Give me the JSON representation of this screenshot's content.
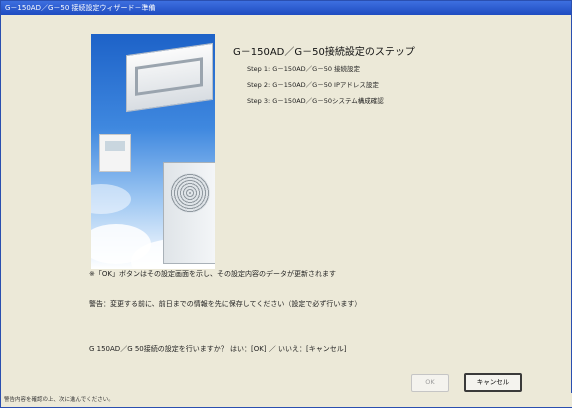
{
  "window": {
    "title": "G－150AD／G－50 接続設定ウィザード－準備"
  },
  "main": {
    "heading": "G－150AD／G－50接続設定のステップ",
    "steps": [
      "Step 1: G－150AD／G－50 接続設定",
      "Step 2: G－150AD／G－50 IPアドレス設定",
      "Step 3: G－150AD／G－50システム構成確認"
    ],
    "note1": "※「OK」ボタンはその設定画面を示し、その設定内容のデータが更新されます",
    "note2": "警告：変更する前に、前日までの情報を先に保存してください（設定で必ず行います）",
    "question": "G 150AD／G 50接続の設定を行いますか？ はい：[OK] ／ いいえ：[キャンセル]"
  },
  "buttons": {
    "ok_label": "OK",
    "cancel_label": "キャンセル"
  },
  "status": {
    "text": "警告内容を確認の上、次に進んでください。"
  }
}
